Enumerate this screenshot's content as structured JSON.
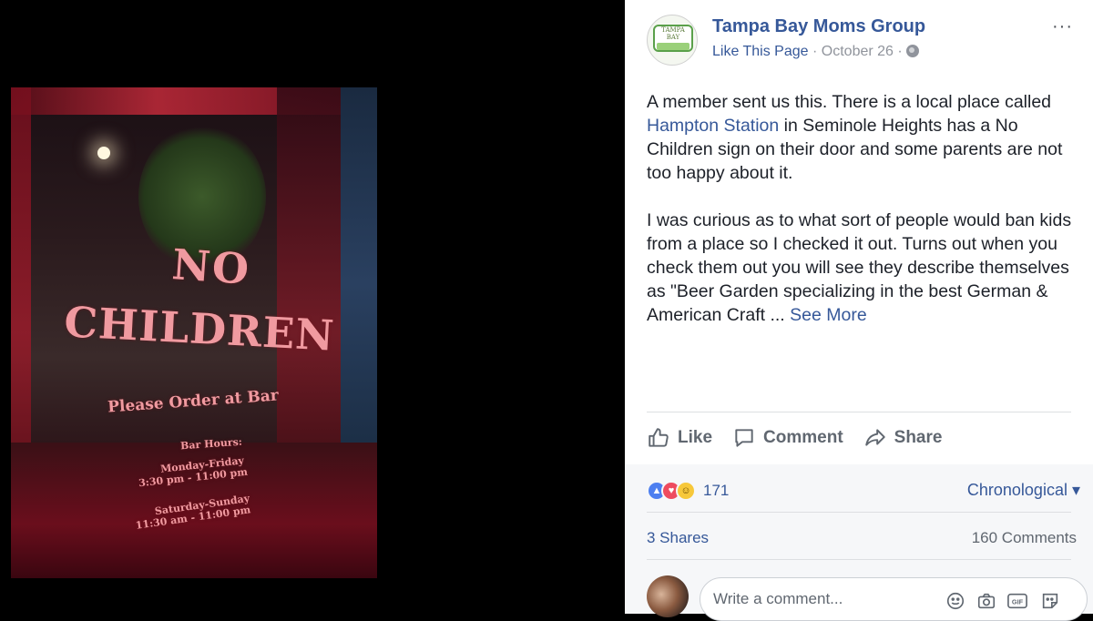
{
  "photo": {
    "sign": {
      "line1": "NO",
      "line2": "CHILDREN",
      "order": "Please Order at Bar",
      "hours_title": "Bar Hours:",
      "weekday_label": "Monday-Friday",
      "weekday_hours": "3:30 pm - 11:00 pm",
      "weekend_label": "Saturday-Sunday",
      "weekend_hours": "11:30 am - 11:00 pm"
    }
  },
  "post": {
    "page_name": "Tampa Bay Moms Group",
    "avatar_text": "TAMPA BAY",
    "like_page": "Like This Page",
    "separator": "·",
    "date": "October 26",
    "more": "···",
    "paragraph1_a": "A member sent us this. There is a local place called ",
    "paragraph1_link": "Hampton Station",
    "paragraph1_b": " in Seminole Heights has a No Children sign on their door and some parents are not too happy about it.",
    "paragraph2": "I was curious as to what sort of people would ban kids from a place so I checked it out. Turns out when you check them out you will see they describe themselves as \"Beer Garden specializing in the best German & American Craft ... ",
    "see_more": "See More"
  },
  "actions": {
    "like": "Like",
    "comment": "Comment",
    "share": "Share"
  },
  "stats": {
    "reaction_count": "171",
    "sort_label": "Chronological ▾",
    "shares": "3 Shares",
    "comments": "160 Comments"
  },
  "composer": {
    "placeholder": "Write a comment..."
  },
  "colors": {
    "link": "#365899",
    "text": "#1d2129",
    "muted": "#90949c"
  }
}
